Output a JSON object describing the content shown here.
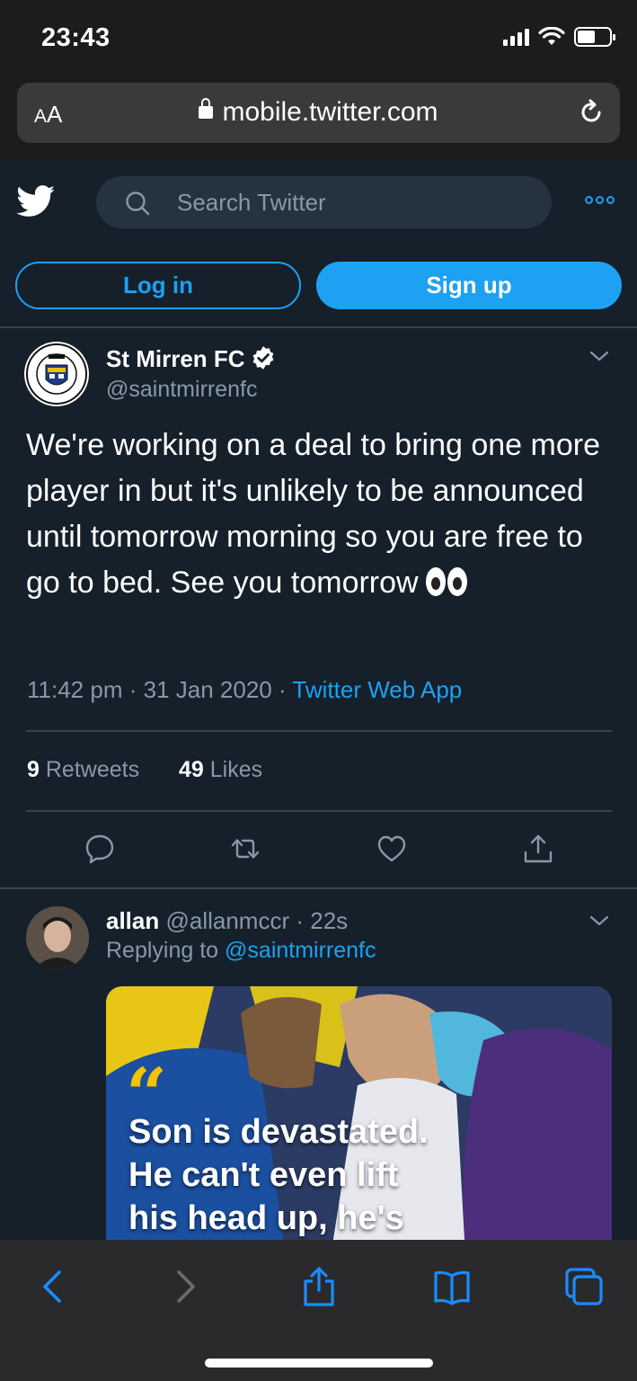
{
  "status_bar": {
    "time": "23:43"
  },
  "browser": {
    "aa_small": "A",
    "aa_big": "A",
    "url": "mobile.twitter.com"
  },
  "header": {
    "search_placeholder": "Search Twitter",
    "login_label": "Log in",
    "signup_label": "Sign up"
  },
  "tweet": {
    "author_name": "St Mirren FC",
    "author_handle": "@saintmirrenfc",
    "text": "We're working on a deal to bring one more player in but it's unlikely to be announced until tomorrow morning so you are free to go to bed. See you tomorrow",
    "time": "11:42 pm",
    "date": "31 Jan 2020",
    "source": "Twitter Web App",
    "retweets_count": "9",
    "retweets_label": "Retweets",
    "likes_count": "49",
    "likes_label": "Likes"
  },
  "reply": {
    "name": "allan",
    "handle": "@allanmccr",
    "age": "22s",
    "replying_prefix": "Replying to",
    "replying_to": "@saintmirrenfc",
    "media_text_lines": [
      "Son is devastated.",
      "He can't even lift",
      "his head up, he's"
    ]
  },
  "colors": {
    "background": "#15202b",
    "accent": "#1da1f2",
    "muted_text": "#8899a6",
    "divider": "#38444d"
  }
}
